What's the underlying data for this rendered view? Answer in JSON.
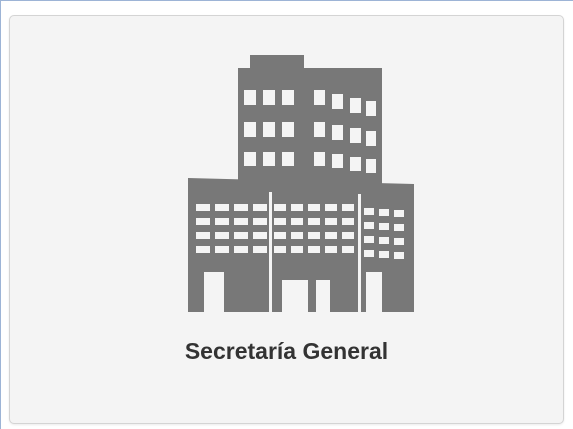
{
  "card": {
    "label": "Secretaría General",
    "icon": "office-building-icon",
    "icon_color": "#787878",
    "background": "#f4f4f4",
    "label_color": "#333333"
  }
}
